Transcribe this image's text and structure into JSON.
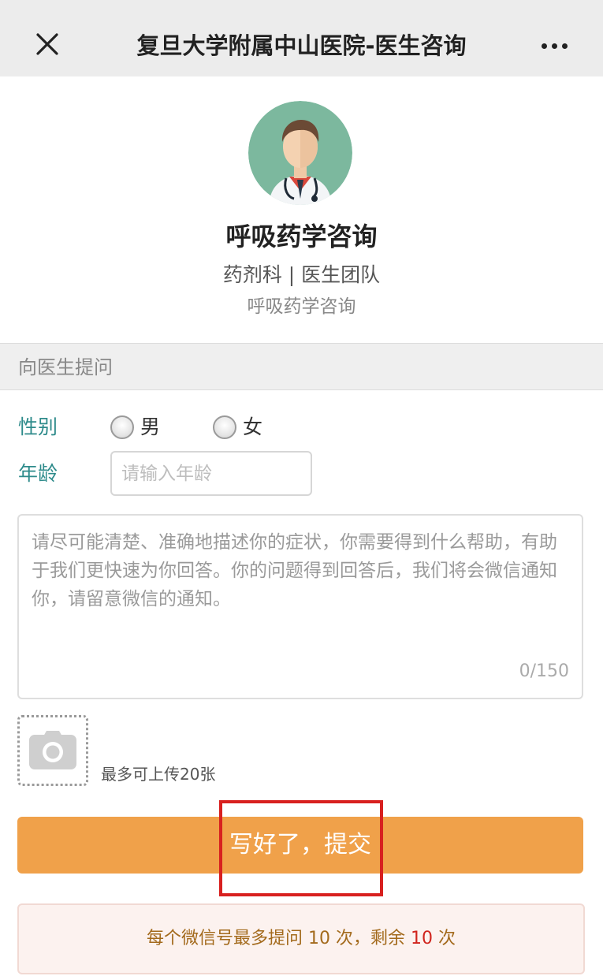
{
  "topbar": {
    "title": "复旦大学附属中山医院-医生咨询",
    "close_icon": "close-icon",
    "more_icon": "more-dots-icon"
  },
  "doctor": {
    "avatar_icon": "doctor-avatar-icon",
    "name": "呼吸药学咨询",
    "dept": "药剂科 | 医生团队",
    "desc": "呼吸药学咨询"
  },
  "section": {
    "label": "向医生提问"
  },
  "form": {
    "gender_label": "性别",
    "gender_options": [
      "男",
      "女"
    ],
    "age_label": "年龄",
    "age_placeholder": "请输入年龄",
    "age_value": "",
    "desc_placeholder": "请尽可能清楚、准确地描述你的症状，你需要得到什么帮助，有助于我们更快速为你回答。你的问题得到回答后，我们将会微信通知你，请留意微信的通知。",
    "desc_count": "0/150",
    "upload_icon": "camera-icon",
    "upload_hint": "最多可上传20张",
    "submit_label": "写好了，提交"
  },
  "notice": {
    "prefix": "每个微信号最多提问",
    "max_count": "10",
    "middle": "次，剩余",
    "remaining": "10",
    "suffix": "次"
  },
  "colors": {
    "accent_teal": "#2e8b8b",
    "submit_orange": "#f0a14a",
    "highlight_red": "#d8201f",
    "notice_bg": "#fcf2ef"
  }
}
